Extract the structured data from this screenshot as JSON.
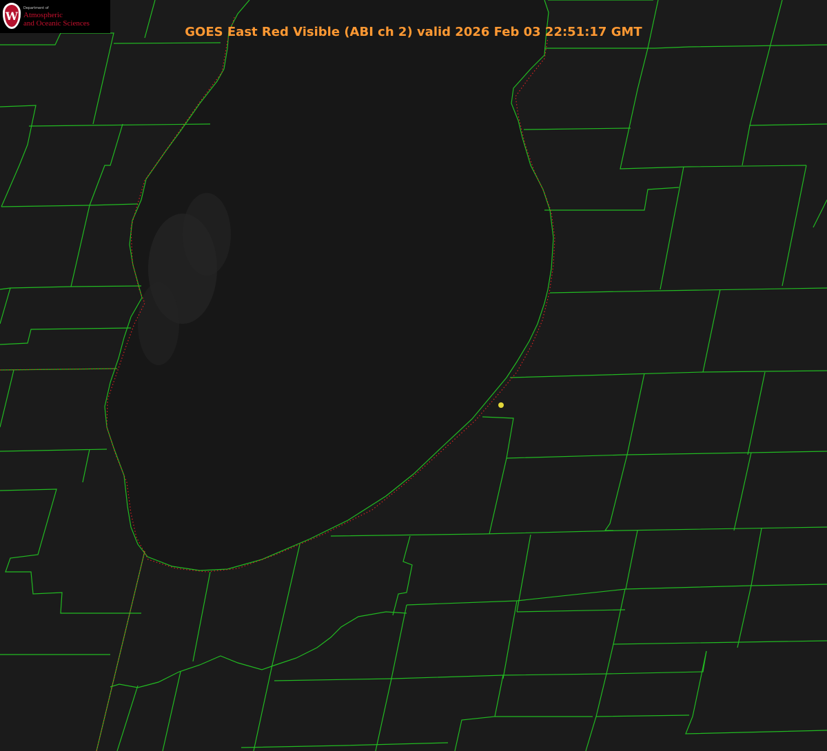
{
  "title": "GOES East Red Visible (ABI ch 2) valid 2026 Feb 03 22:51:17 GMT",
  "logo": {
    "department": "Department of",
    "line1": "Atmospheric",
    "line2": "and Oceanic Sciences",
    "crest_letter": "W"
  },
  "colors": {
    "background": "#1b1b1b",
    "lake": "#171717",
    "county_lines": "#22bb22",
    "shoreline_dots": "#dd2222",
    "title_text": "#ff9933",
    "logo_text": "#c8102e",
    "marker": "#e2d73a"
  },
  "icons": {
    "crest": "uw-crest-icon",
    "marker": "location-dot-icon"
  }
}
